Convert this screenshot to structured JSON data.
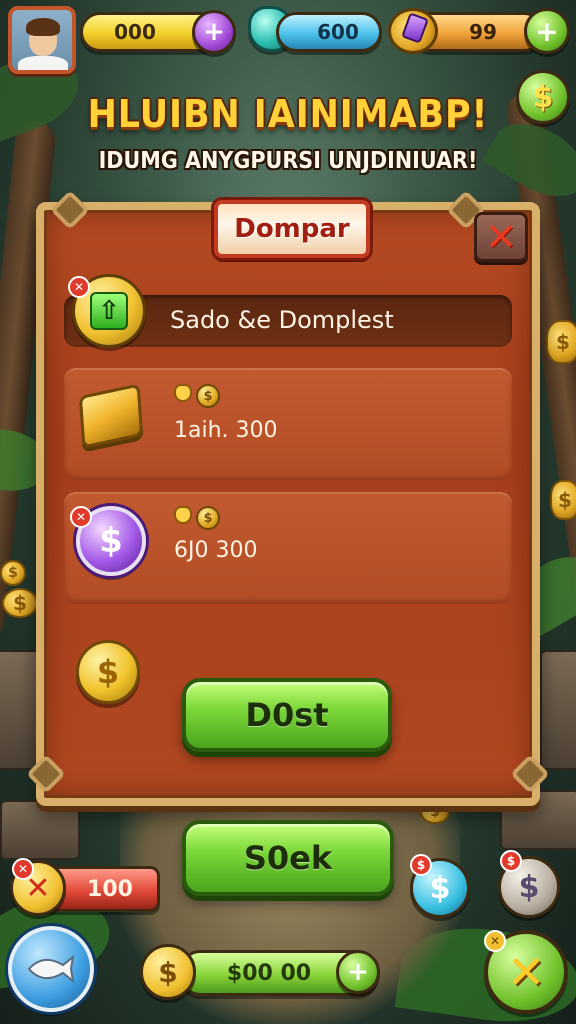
{
  "hud": {
    "gold_value": "000",
    "gem_value": "600",
    "resource_value": "99"
  },
  "title": "HLUIBN IAINIMABP!",
  "subtitle": "IDUMG ANYGPURSI UNJDINIUAR!",
  "panel": {
    "header": "Dompar",
    "close_symbol": "✕",
    "top_row_label": "Sado &e Domplest",
    "offers": [
      {
        "price": "1aih. 300",
        "icon": "gold-bar-icon"
      },
      {
        "price": "6J0 300",
        "icon": "purple-dollar-coin-icon"
      }
    ],
    "main_button": "D0st"
  },
  "bottom": {
    "seek_button": "S0ek",
    "left_counter": "100",
    "coin_counter": "$00 00"
  },
  "colors": {
    "panel": "#b24820",
    "frame": "#d9b06a",
    "button_green": "#7cd83a",
    "title_gold": "#ffd23a"
  }
}
